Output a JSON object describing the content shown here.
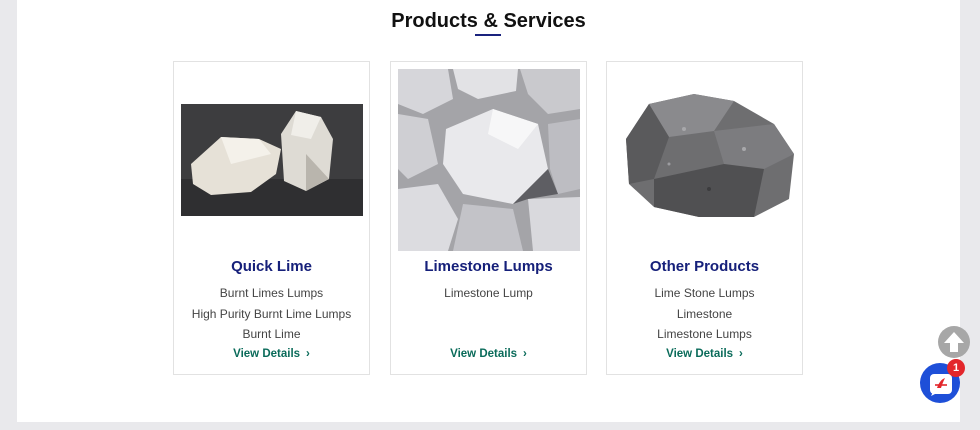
{
  "section": {
    "title": "Products & Services"
  },
  "cards": [
    {
      "title": "Quick Lime",
      "items": [
        "Burnt Limes Lumps",
        "High Purity Burnt Lime Lumps",
        "Burnt Lime"
      ],
      "cta": "View Details"
    },
    {
      "title": "Limestone Lumps",
      "items": [
        "Limestone Lump"
      ],
      "cta": "View Details"
    },
    {
      "title": "Other Products",
      "items": [
        "Lime Stone Lumps",
        "Limestone",
        "Limestone Lumps"
      ],
      "cta": "View Details"
    }
  ],
  "chevron": "›",
  "chat_badge": "1",
  "colors": {
    "title": "#16207a",
    "cta": "#0a6b5a",
    "accent": "#1a237e",
    "chat": "#1e4fd8",
    "badge": "#e3262b"
  },
  "icons": [
    "arrow-up-icon",
    "chat-icon",
    "chevron-right-icon"
  ]
}
